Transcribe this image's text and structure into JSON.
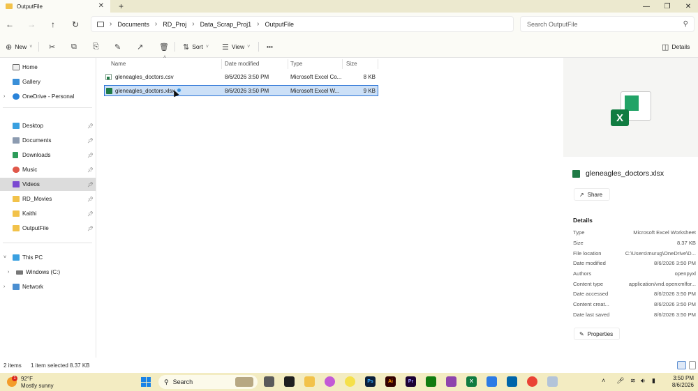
{
  "window": {
    "tab_title": "OutputFile",
    "close_tab": "✕",
    "new_tab": "+",
    "minimize": "—",
    "maximize": "❐",
    "close": "✕"
  },
  "address": {
    "breadcrumbs": [
      "Documents",
      "RD_Proj",
      "Data_Scrap_Proj1",
      "OutputFile"
    ],
    "search_placeholder": "Search OutputFile"
  },
  "commands": {
    "new_label": "New",
    "sort_label": "Sort",
    "view_label": "View",
    "more_label": "•••",
    "details_label": "Details"
  },
  "sidebar": {
    "top": [
      {
        "label": "Home",
        "icon": "home-icon"
      },
      {
        "label": "Gallery",
        "icon": "gallery-icon"
      },
      {
        "label": "OneDrive - Personal",
        "icon": "onedrive-icon"
      }
    ],
    "quick_access": [
      {
        "label": "Desktop",
        "icon": "desktop-icon",
        "color": "#3aa0e0"
      },
      {
        "label": "Documents",
        "icon": "documents-icon",
        "color": "#8c9bb0"
      },
      {
        "label": "Downloads",
        "icon": "downloads-icon",
        "color": "#2d9c5a"
      },
      {
        "label": "Music",
        "icon": "music-icon",
        "color": "#e0584a"
      },
      {
        "label": "Videos",
        "icon": "videos-icon",
        "color": "#7b4ad1"
      },
      {
        "label": "RD_Movies",
        "icon": "folder-icon",
        "color": "#f2c24a"
      },
      {
        "label": "Kaithi",
        "icon": "folder-icon",
        "color": "#f2c24a"
      },
      {
        "label": "OutputFile",
        "icon": "folder-icon",
        "color": "#f2c24a"
      }
    ],
    "this_pc": {
      "label": "This PC",
      "icon": "pc-icon"
    },
    "windows_c": {
      "label": "Windows (C:)",
      "icon": "drive-icon"
    },
    "network": {
      "label": "Network",
      "icon": "network-icon"
    },
    "selected": "Videos"
  },
  "columns": {
    "name": "Name",
    "date": "Date modified",
    "type": "Type",
    "size": "Size"
  },
  "files": [
    {
      "name": "gleneagles_doctors.csv",
      "date": "8/6/2026 3:50 PM",
      "type": "Microsoft Excel Co...",
      "size": "8 KB",
      "selected": false
    },
    {
      "name": "gleneagles_doctors.xlsx",
      "date": "8/6/2026 3:50 PM",
      "type": "Microsoft Excel W...",
      "size": "9 KB",
      "selected": true
    }
  ],
  "details": {
    "filename": "gleneagles_doctors.xlsx",
    "share_label": "Share",
    "heading": "Details",
    "properties": [
      {
        "key": "Type",
        "value": "Microsoft Excel Worksheet"
      },
      {
        "key": "Size",
        "value": "8.37 KB"
      },
      {
        "key": "File location",
        "value": "C:\\Users\\murug\\OneDrive\\D..."
      },
      {
        "key": "Date modified",
        "value": "8/6/2026 3:50 PM"
      },
      {
        "key": "Authors",
        "value": "openpyxl"
      },
      {
        "key": "Content type",
        "value": "application/vnd.openxmlfor..."
      },
      {
        "key": "Date accessed",
        "value": "8/6/2026 3:50 PM"
      },
      {
        "key": "Content creat...",
        "value": "8/6/2026 3:50 PM"
      },
      {
        "key": "Date last saved",
        "value": "8/6/2026 3:50 PM"
      }
    ],
    "properties_label": "Properties"
  },
  "status": {
    "items": "2 items",
    "selected": "1 item selected  8.37 KB"
  },
  "taskbar": {
    "temp": "92°F",
    "weather": "Mostly sunny",
    "weather_badge": "1",
    "search_label": "Search",
    "time": "3:50 PM",
    "date": "8/6/2026"
  }
}
